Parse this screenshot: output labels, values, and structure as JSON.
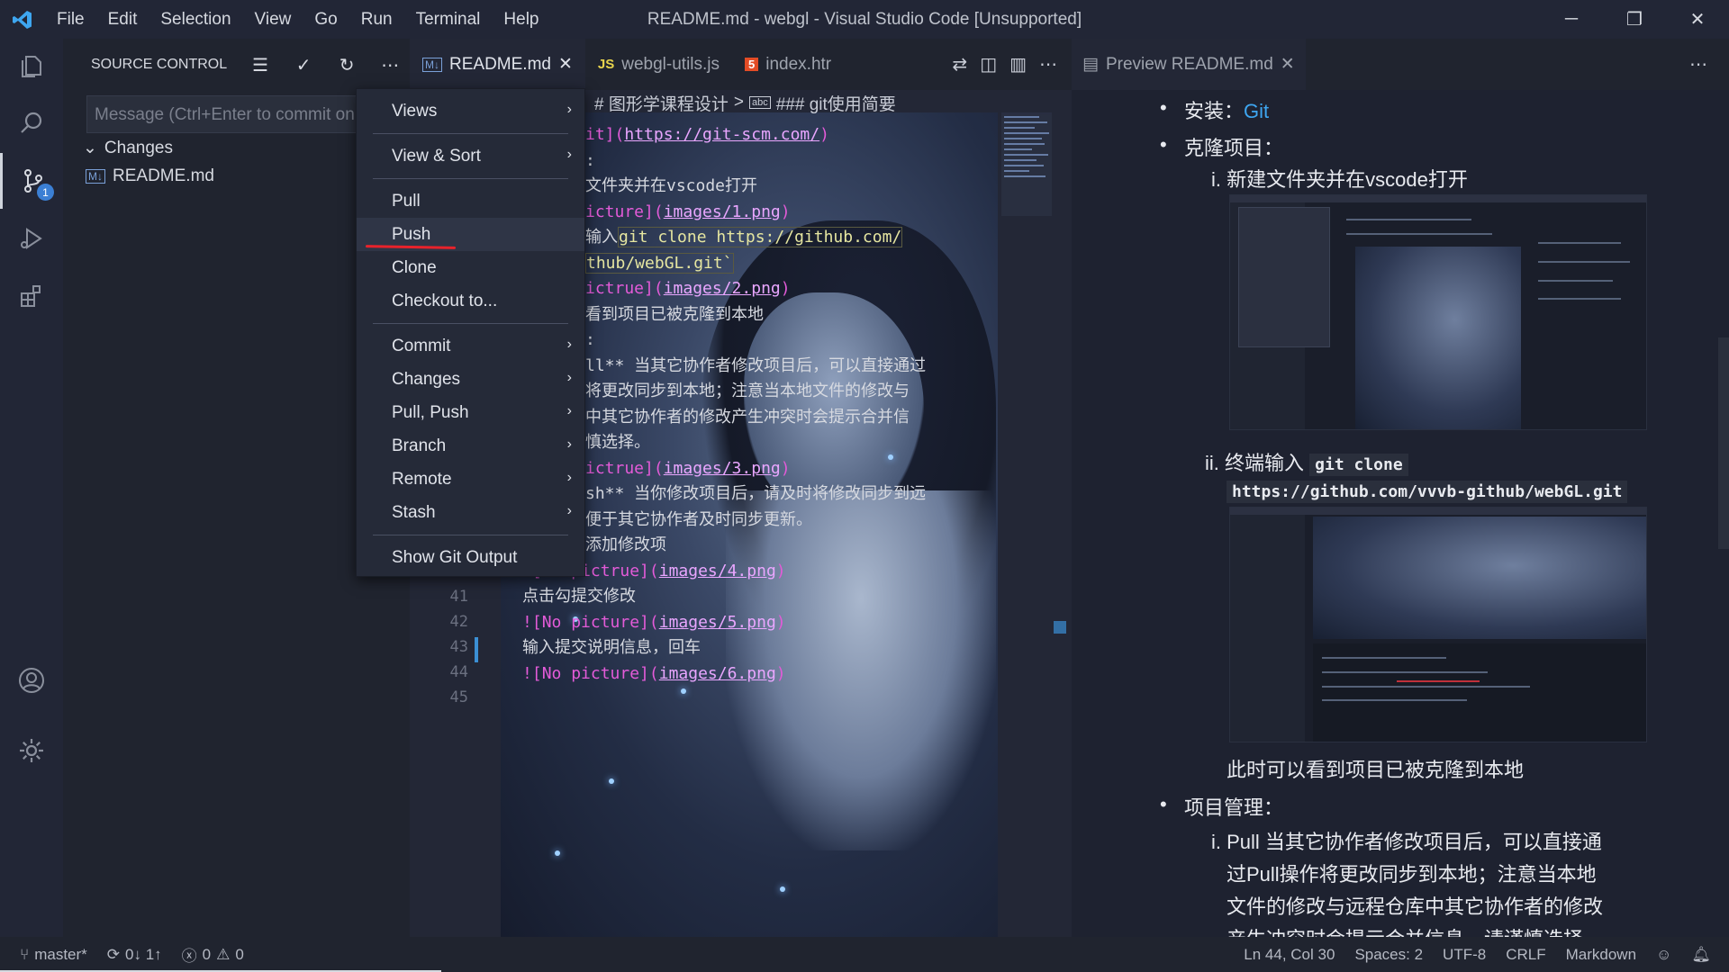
{
  "window": {
    "title": "README.md - webgl - Visual Studio Code [Unsupported]",
    "menu": [
      "File",
      "Edit",
      "Selection",
      "View",
      "Go",
      "Run",
      "Terminal",
      "Help"
    ]
  },
  "sidebar": {
    "title": "SOURCE CONTROL",
    "message_placeholder": "Message (Ctrl+Enter to commit on",
    "changes_label": "Changes",
    "file_name": "README.md",
    "badge_count": "1"
  },
  "tabs": [
    {
      "icon": "M↓",
      "label": "README.md"
    },
    {
      "icon": "JS",
      "label": "webgl-utils.js"
    },
    {
      "icon": "5",
      "label": "index.htr"
    }
  ],
  "breadcrumb": {
    "part1": "# 图形学课程设计",
    "sep": ">",
    "part2": "### git使用简要"
  },
  "context_menu": [
    {
      "label": "Views",
      "submenu": true
    },
    {
      "sep": true
    },
    {
      "label": "View & Sort",
      "submenu": true
    },
    {
      "sep": true
    },
    {
      "label": "Pull"
    },
    {
      "label": "Push",
      "highlight": true
    },
    {
      "label": "Clone"
    },
    {
      "label": "Checkout to..."
    },
    {
      "sep": true
    },
    {
      "label": "Commit",
      "submenu": true
    },
    {
      "label": "Changes",
      "submenu": true
    },
    {
      "label": "Pull, Push",
      "submenu": true
    },
    {
      "label": "Branch",
      "submenu": true
    },
    {
      "label": "Remote",
      "submenu": true
    },
    {
      "label": "Stash",
      "submenu": true
    },
    {
      "sep": true
    },
    {
      "label": "Show Git Output"
    }
  ],
  "code_lines": [
    {
      "pre": "",
      "a": "it](",
      "b": "https://git-scm.com/",
      "c": ")"
    },
    {
      "text": ":"
    },
    {
      "text": "文件夹并在vscode打开"
    },
    {
      "pre": "",
      "a": "icture](",
      "b": "images/1.png",
      "c": ")"
    },
    {
      "text": "输入",
      "inline": "git clone https://github.com/"
    },
    {
      "inline2": "thub/webGL.git`"
    },
    {
      "pre": "",
      "a": "ictrue](",
      "b": "images/2.png",
      "c": ")"
    },
    {
      "text": "看到项目已被克隆到本地"
    },
    {
      "text": ":"
    },
    {
      "text": "ll** 当其它协作者修改项目后，可以直接通过"
    },
    {
      "text": "将更改同步到本地；注意当本地文件的修改与"
    },
    {
      "text": "中其它协作者的修改产生冲突时会提示合并信"
    },
    {
      "text": "慎选择。"
    },
    {
      "pre": "",
      "a": "ictrue](",
      "b": "images/3.png",
      "c": ")"
    },
    {
      "text": "sh** 当你修改项目后，请及时将修改同步到远"
    },
    {
      "text": "便于其它协作者及时同步更新。"
    },
    {
      "text": "添加修改项"
    },
    {
      "pre": "![",
      "a": "No pictrue](",
      "b": "images/4.png",
      "c": ")"
    },
    {
      "text": "点击勾提交修改"
    },
    {
      "pre": "![",
      "a": "No picture](",
      "b": "images/5.png",
      "c": ")"
    },
    {
      "text": "输入提交说明信息，回车"
    },
    {
      "pre": "![",
      "a": "No picture](",
      "b": "images/6.png",
      "c": ")"
    },
    {
      "text": ""
    }
  ],
  "line_numbers": [
    "41",
    "42",
    "43",
    "44",
    "45"
  ],
  "preview": {
    "tab_label": "Preview README.md",
    "install_label": "安装：",
    "install_link": "Git",
    "clone_label": "克隆项目：",
    "step1": "i. 新建文件夹并在vscode打开",
    "step2_pre": "ii. 终端输入",
    "step2_code1": "git clone",
    "step2_code2": "https://github.com/vvvb-github/webGL.git",
    "cloned_text": "此时可以看到项目已被克隆到本地",
    "manage_label": "项目管理：",
    "pull_line1": "i. Pull 当其它协作者修改项目后，可以直接通",
    "pull_line2": "过Pull操作将更改同步到本地；注意当本地",
    "pull_line3": "文件的修改与远程仓库中其它协作者的修改",
    "pull_line4": "产生冲突时会提示合并信息，请谨慎选择。"
  },
  "statusbar": {
    "branch": "master*",
    "sync": "0↓ 1↑",
    "errors": "0",
    "warnings": "0",
    "position": "Ln 44, Col 30",
    "spaces": "Spaces: 2",
    "encoding": "UTF-8",
    "eol": "CRLF",
    "language": "Markdown"
  },
  "colors": {
    "accent": "#3b7fd4",
    "annotation": "#e8222b"
  }
}
